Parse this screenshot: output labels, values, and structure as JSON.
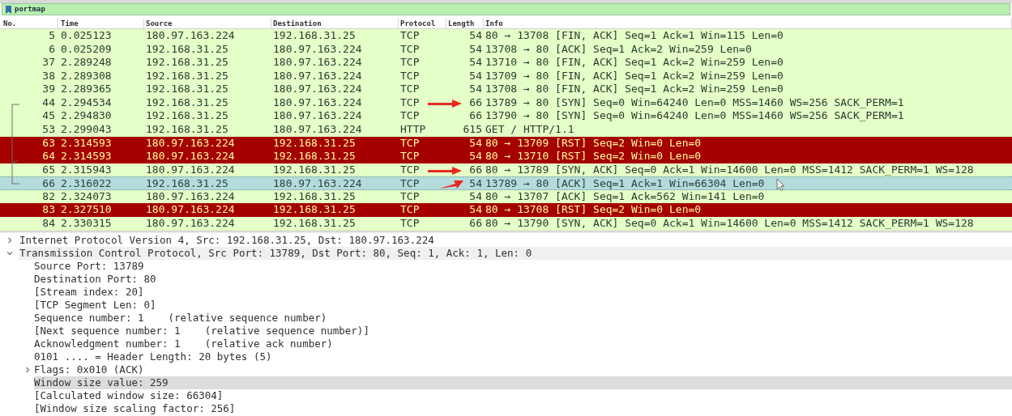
{
  "filter_bar": {
    "text": "portmap"
  },
  "packet_list": {
    "columns": [
      "No.",
      "Time",
      "Source",
      "Destination",
      "Protocol",
      "Length",
      "Info"
    ],
    "rows": [
      {
        "no": "5",
        "time": "0.025123",
        "source": "180.97.163.224",
        "destination": "192.168.31.25",
        "protocol": "TCP",
        "length": "54",
        "info": "80 → 13708 [FIN, ACK] Seq=1 Ack=1 Win=115 Len=0",
        "color": "#e4ffc7",
        "selected": false
      },
      {
        "no": "6",
        "time": "0.025209",
        "source": "192.168.31.25",
        "destination": "180.97.163.224",
        "protocol": "TCP",
        "length": "54",
        "info": "13708 → 80 [ACK] Seq=1 Ack=2 Win=259 Len=0",
        "color": "#e4ffc7",
        "selected": false
      },
      {
        "no": "37",
        "time": "2.289248",
        "source": "192.168.31.25",
        "destination": "180.97.163.224",
        "protocol": "TCP",
        "length": "54",
        "info": "13710 → 80 [FIN, ACK] Seq=1 Ack=2 Win=259 Len=0",
        "color": "#e4ffc7",
        "selected": false
      },
      {
        "no": "38",
        "time": "2.289308",
        "source": "192.168.31.25",
        "destination": "180.97.163.224",
        "protocol": "TCP",
        "length": "54",
        "info": "13709 → 80 [FIN, ACK] Seq=1 Ack=2 Win=259 Len=0",
        "color": "#e4ffc7",
        "selected": false
      },
      {
        "no": "39",
        "time": "2.289365",
        "source": "192.168.31.25",
        "destination": "180.97.163.224",
        "protocol": "TCP",
        "length": "54",
        "info": "13708 → 80 [FIN, ACK] Seq=1 Ack=2 Win=259 Len=0",
        "color": "#e4ffc7",
        "selected": false
      },
      {
        "no": "44",
        "time": "2.294534",
        "source": "192.168.31.25",
        "destination": "180.97.163.224",
        "protocol": "TCP",
        "length": "66",
        "info": "13789 → 80 [SYN] Seq=0 Win=64240 Len=0 MSS=1460 WS=256 SACK_PERM=1",
        "color": "#e4ffc7",
        "selected": false
      },
      {
        "no": "45",
        "time": "2.294830",
        "source": "192.168.31.25",
        "destination": "180.97.163.224",
        "protocol": "TCP",
        "length": "66",
        "info": "13790 → 80 [SYN] Seq=0 Win=64240 Len=0 MSS=1460 WS=256 SACK_PERM=1",
        "color": "#e4ffc7",
        "selected": false
      },
      {
        "no": "53",
        "time": "2.299043",
        "source": "192.168.31.25",
        "destination": "180.97.163.224",
        "protocol": "HTTP",
        "length": "615",
        "info": "GET / HTTP/1.1",
        "color": "#e4ffc7",
        "selected": false
      },
      {
        "no": "63",
        "time": "2.314593",
        "source": "180.97.163.224",
        "destination": "192.168.31.25",
        "protocol": "TCP",
        "length": "54",
        "info": "80 → 13709 [RST] Seq=2 Win=0 Len=0",
        "color": "#a40000",
        "selected": false
      },
      {
        "no": "64",
        "time": "2.314593",
        "source": "180.97.163.224",
        "destination": "192.168.31.25",
        "protocol": "TCP",
        "length": "54",
        "info": "80 → 13710 [RST] Seq=2 Win=0 Len=0",
        "color": "#a40000",
        "selected": false
      },
      {
        "no": "65",
        "time": "2.315943",
        "source": "180.97.163.224",
        "destination": "192.168.31.25",
        "protocol": "TCP",
        "length": "66",
        "info": "80 → 13789 [SYN, ACK] Seq=0 Ack=1 Win=14600 Len=0 MSS=1412 SACK_PERM=1 WS=128",
        "color": "#e4ffc7",
        "selected": false
      },
      {
        "no": "66",
        "time": "2.316022",
        "source": "192.168.31.25",
        "destination": "180.97.163.224",
        "protocol": "TCP",
        "length": "54",
        "info": "13789 → 80 [ACK] Seq=1 Ack=1 Win=66304 Len=0",
        "color": "#b4dcdc",
        "selected": true
      },
      {
        "no": "82",
        "time": "2.324073",
        "source": "180.97.163.224",
        "destination": "192.168.31.25",
        "protocol": "TCP",
        "length": "54",
        "info": "80 → 13707 [ACK] Seq=1 Ack=562 Win=141 Len=0",
        "color": "#e4ffc7",
        "selected": false
      },
      {
        "no": "83",
        "time": "2.327510",
        "source": "180.97.163.224",
        "destination": "192.168.31.25",
        "protocol": "TCP",
        "length": "54",
        "info": "80 → 13708 [RST] Seq=2 Win=0 Len=0",
        "color": "#a40000",
        "selected": false
      },
      {
        "no": "84",
        "time": "2.330315",
        "source": "180.97.163.224",
        "destination": "192.168.31.25",
        "protocol": "TCP",
        "length": "66",
        "info": "80 → 13790 [SYN, ACK] Seq=0 Ack=1 Win=14600 Len=0 MSS=1412 SACK_PERM=1 WS=128",
        "color": "#e4ffc7",
        "selected": false
      }
    ]
  },
  "packet_details": {
    "items": [
      {
        "text": "Internet Protocol Version 4, Src: 192.168.31.25, Dst: 180.97.163.224",
        "expanded": false,
        "selected": false
      },
      {
        "text": "Transmission Control Protocol, Src Port: 13789, Dst Port: 80, Seq: 1, Ack: 1, Len: 0",
        "expanded": true,
        "selected": false,
        "children": [
          {
            "text": "Source Port: 13789",
            "selected": false
          },
          {
            "text": "Destination Port: 80",
            "selected": false
          },
          {
            "text": "[Stream index: 20]",
            "selected": false
          },
          {
            "text": "[TCP Segment Len: 0]",
            "selected": false
          },
          {
            "text": "Sequence number: 1    (relative sequence number)",
            "selected": false
          },
          {
            "text": "[Next sequence number: 1    (relative sequence number)]",
            "selected": false
          },
          {
            "text": "Acknowledgment number: 1    (relative ack number)",
            "selected": false
          },
          {
            "text": "0101 .... = Header Length: 20 bytes (5)",
            "selected": false
          },
          {
            "text": "Flags: 0x010 (ACK)",
            "expanded": false,
            "selected": false
          },
          {
            "text": "Window size value: 259",
            "selected": true
          },
          {
            "text": "[Calculated window size: 66304]",
            "selected": false
          },
          {
            "text": "[Window size scaling factor: 256]",
            "selected": false
          }
        ]
      }
    ]
  }
}
